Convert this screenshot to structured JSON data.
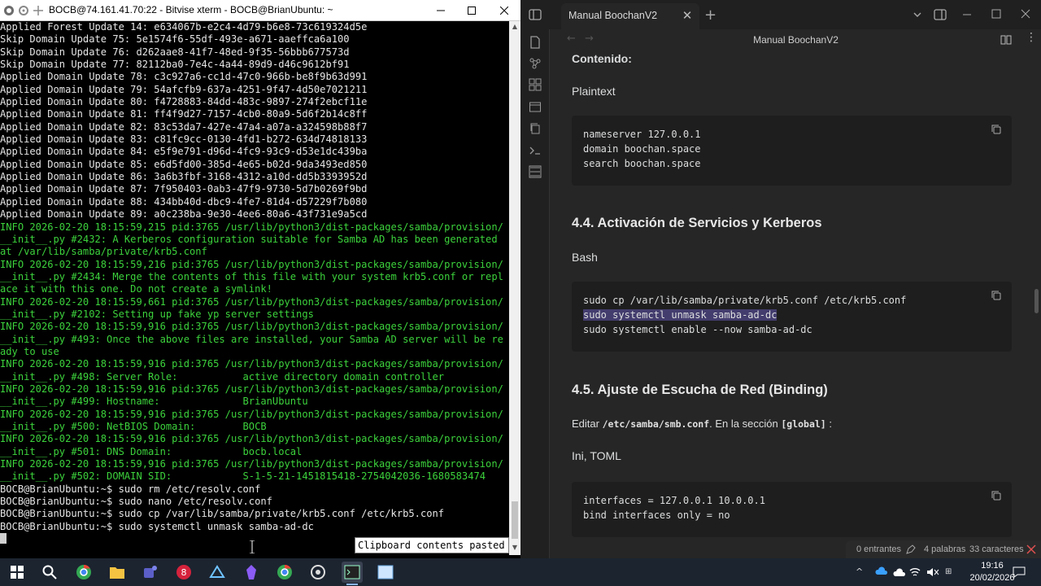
{
  "terminal": {
    "title": "BOCB@74.161.41.70:22 - Bitvise xterm - BOCB@BrianUbuntu: ~",
    "lines": [
      {
        "t": "Applied Forest Update 14: e634067b-e2c4-4d79-b6e8-73c619324d5e",
        "c": "w"
      },
      {
        "t": "Skip Domain Update 75: 5e1574f6-55df-493e-a671-aaeffca6a100",
        "c": "w"
      },
      {
        "t": "Skip Domain Update 76: d262aae8-41f7-48ed-9f35-56bbb677573d",
        "c": "w"
      },
      {
        "t": "Skip Domain Update 77: 82112ba0-7e4c-4a44-89d9-d46c9612bf91",
        "c": "w"
      },
      {
        "t": "Applied Domain Update 78: c3c927a6-cc1d-47c0-966b-be8f9b63d991",
        "c": "w"
      },
      {
        "t": "Applied Domain Update 79: 54afcfb9-637a-4251-9f47-4d50e7021211",
        "c": "w"
      },
      {
        "t": "Applied Domain Update 80: f4728883-84dd-483c-9897-274f2ebcf11e",
        "c": "w"
      },
      {
        "t": "Applied Domain Update 81: ff4f9d27-7157-4cb0-80a9-5d6f2b14c8ff",
        "c": "w"
      },
      {
        "t": "Applied Domain Update 82: 83c53da7-427e-47a4-a07a-a324598b88f7",
        "c": "w"
      },
      {
        "t": "Applied Domain Update 83: c81fc9cc-0130-4fd1-b272-634d74818133",
        "c": "w"
      },
      {
        "t": "Applied Domain Update 84: e5f9e791-d96d-4fc9-93c9-d53e1dc439ba",
        "c": "w"
      },
      {
        "t": "Applied Domain Update 85: e6d5fd00-385d-4e65-b02d-9da3493ed850",
        "c": "w"
      },
      {
        "t": "Applied Domain Update 86: 3a6b3fbf-3168-4312-a10d-dd5b3393952d",
        "c": "w"
      },
      {
        "t": "Applied Domain Update 87: 7f950403-0ab3-47f9-9730-5d7b0269f9bd",
        "c": "w"
      },
      {
        "t": "Applied Domain Update 88: 434bb40d-dbc9-4fe7-81d4-d57229f7b080",
        "c": "w"
      },
      {
        "t": "Applied Domain Update 89: a0c238ba-9e30-4ee6-80a6-43f731e9a5cd",
        "c": "w"
      },
      {
        "t": "INFO 2026-02-20 18:15:59,215 pid:3765 /usr/lib/python3/dist-packages/samba/provision/",
        "c": "g"
      },
      {
        "t": "__init__.py #2432: A Kerberos configuration suitable for Samba AD has been generated",
        "c": "g"
      },
      {
        "t": "at /var/lib/samba/private/krb5.conf",
        "c": "g"
      },
      {
        "t": "INFO 2026-02-20 18:15:59,216 pid:3765 /usr/lib/python3/dist-packages/samba/provision/",
        "c": "g"
      },
      {
        "t": "__init__.py #2434: Merge the contents of this file with your system krb5.conf or repl",
        "c": "g"
      },
      {
        "t": "ace it with this one. Do not create a symlink!",
        "c": "g"
      },
      {
        "t": "INFO 2026-02-20 18:15:59,661 pid:3765 /usr/lib/python3/dist-packages/samba/provision/",
        "c": "g"
      },
      {
        "t": "__init__.py #2102: Setting up fake yp server settings",
        "c": "g"
      },
      {
        "t": "INFO 2026-02-20 18:15:59,916 pid:3765 /usr/lib/python3/dist-packages/samba/provision/",
        "c": "g"
      },
      {
        "t": "__init__.py #493: Once the above files are installed, your Samba AD server will be re",
        "c": "g"
      },
      {
        "t": "ady to use",
        "c": "g"
      },
      {
        "t": "INFO 2026-02-20 18:15:59,916 pid:3765 /usr/lib/python3/dist-packages/samba/provision/",
        "c": "g"
      },
      {
        "t": "__init__.py #498: Server Role:           active directory domain controller",
        "c": "g"
      },
      {
        "t": "INFO 2026-02-20 18:15:59,916 pid:3765 /usr/lib/python3/dist-packages/samba/provision/",
        "c": "g"
      },
      {
        "t": "__init__.py #499: Hostname:              BrianUbuntu",
        "c": "g"
      },
      {
        "t": "INFO 2026-02-20 18:15:59,916 pid:3765 /usr/lib/python3/dist-packages/samba/provision/",
        "c": "g"
      },
      {
        "t": "__init__.py #500: NetBIOS Domain:        BOCB",
        "c": "g"
      },
      {
        "t": "INFO 2026-02-20 18:15:59,916 pid:3765 /usr/lib/python3/dist-packages/samba/provision/",
        "c": "g"
      },
      {
        "t": "__init__.py #501: DNS Domain:            bocb.local",
        "c": "g"
      },
      {
        "t": "INFO 2026-02-20 18:15:59,916 pid:3765 /usr/lib/python3/dist-packages/samba/provision/",
        "c": "g"
      },
      {
        "t": "__init__.py #502: DOMAIN SID:            S-1-5-21-1451815418-2754042036-1680583474",
        "c": "g"
      },
      {
        "t": "BOCB@BrianUbuntu:~$ sudo rm /etc/resolv.conf",
        "c": "w"
      },
      {
        "t": "BOCB@BrianUbuntu:~$ sudo nano /etc/resolv.conf",
        "c": "w"
      },
      {
        "t": "BOCB@BrianUbuntu:~$ sudo cp /var/lib/samba/private/krb5.conf /etc/krb5.conf",
        "c": "w"
      },
      {
        "t": "BOCB@BrianUbuntu:~$ sudo systemctl unmask samba-ad-dc",
        "c": "w"
      }
    ],
    "tooltip": "Clipboard contents pasted"
  },
  "obsidian": {
    "tab_title": "Manual BoochanV2",
    "page_title": "Manual BoochanV2",
    "contenido": "Contenido:",
    "lang1": "Plaintext",
    "code1": [
      "nameserver 127.0.0.1",
      "domain boochan.space",
      "search boochan.space"
    ],
    "h44": "4.4. Activación de Servicios y Kerberos",
    "lang2": "Bash",
    "code2": [
      "sudo cp /var/lib/samba/private/krb5.conf /etc/krb5.conf",
      "sudo systemctl unmask samba-ad-dc",
      "sudo systemctl enable --now samba-ad-dc"
    ],
    "h45": "4.5. Ajuste de Escucha de Red (Binding)",
    "editar": "Editar",
    "editar_path": "/etc/samba/smb.conf",
    "editar_mid": ". En la sección",
    "editar_sec": "[global]",
    "editar_end": ":",
    "lang3": "Ini, TOML",
    "code3": [
      "interfaces = 127.0.0.1 10.0.0.1",
      "bind interfaces only = no"
    ],
    "status": {
      "backlinks": "0 entrantes",
      "words": "4 palabras",
      "chars": "33 caracteres"
    }
  },
  "taskbar": {
    "time": "19:16",
    "date": "20/02/2026"
  },
  "colors": {
    "terminal_green": "#3cd23c",
    "obsidian_bg": "#262626",
    "highlight": "#433d6e"
  }
}
